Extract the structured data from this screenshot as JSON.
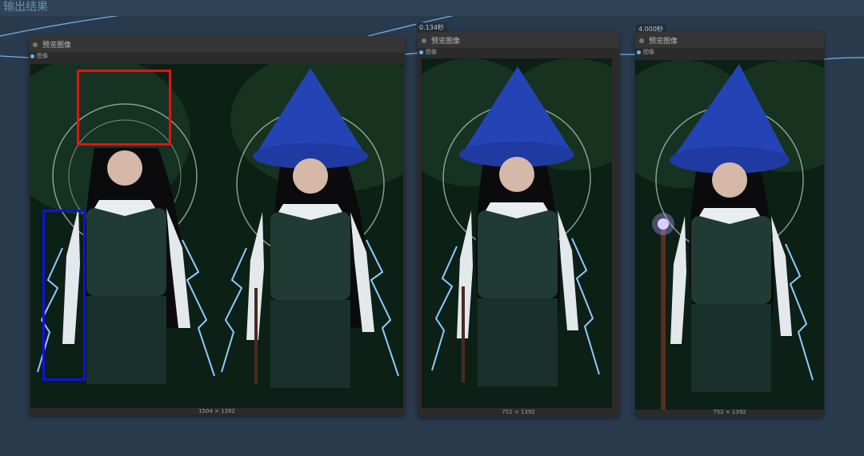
{
  "section_title": "输出结果",
  "nodes": [
    {
      "title": "预览图像",
      "port_label": "图像",
      "dims": "1504 × 1392",
      "time": ""
    },
    {
      "title": "预览图像",
      "port_label": "图像",
      "dims": "752 × 1392",
      "time": "0.134秒"
    },
    {
      "title": "预览图像",
      "port_label": "图像",
      "dims": "752 × 1392",
      "time": "4.000秒"
    }
  ],
  "colors": {
    "canvas": "#2a3a4d",
    "node_body": "#2b2b2b",
    "wire": "#6fb3e8",
    "highlight_red": "#e81111",
    "highlight_blue": "#1010e0"
  }
}
